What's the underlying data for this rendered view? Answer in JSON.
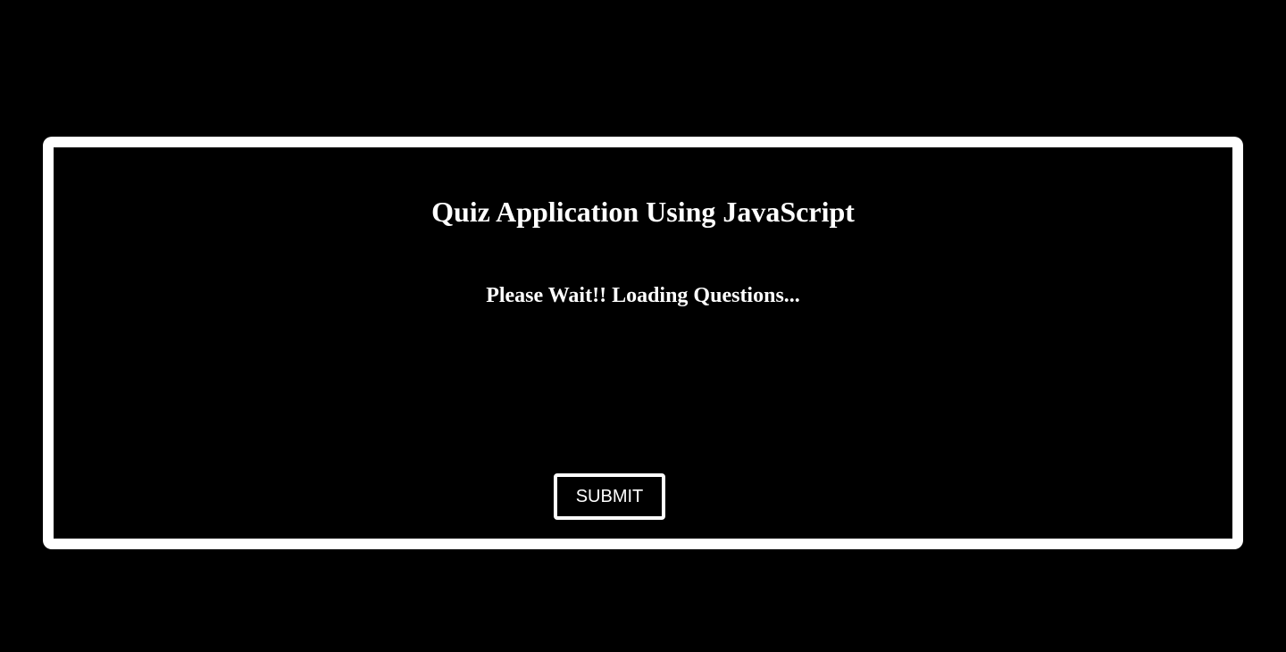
{
  "quiz": {
    "title": "Quiz Application Using JavaScript",
    "status_message": "Please Wait!! Loading Questions...",
    "submit_label": "SUBMIT"
  },
  "colors": {
    "background": "#000000",
    "foreground": "#ffffff",
    "border": "#ffffff"
  }
}
